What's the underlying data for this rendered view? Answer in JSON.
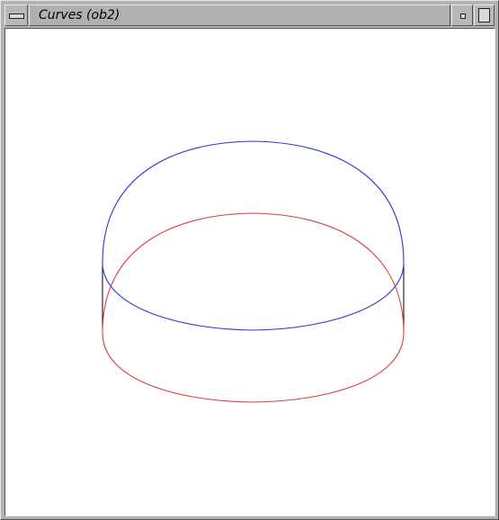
{
  "window": {
    "title": "Curves (ob2)"
  },
  "icons": {
    "window_menu": "window-menu-icon",
    "minimize": "minimize-icon",
    "maximize": "maximize-icon"
  },
  "colors": {
    "upper_curve": "#3333dd",
    "lower_curve": "#e03c3c",
    "connector_lines": "#000000",
    "canvas_background": "#ffffff"
  }
}
